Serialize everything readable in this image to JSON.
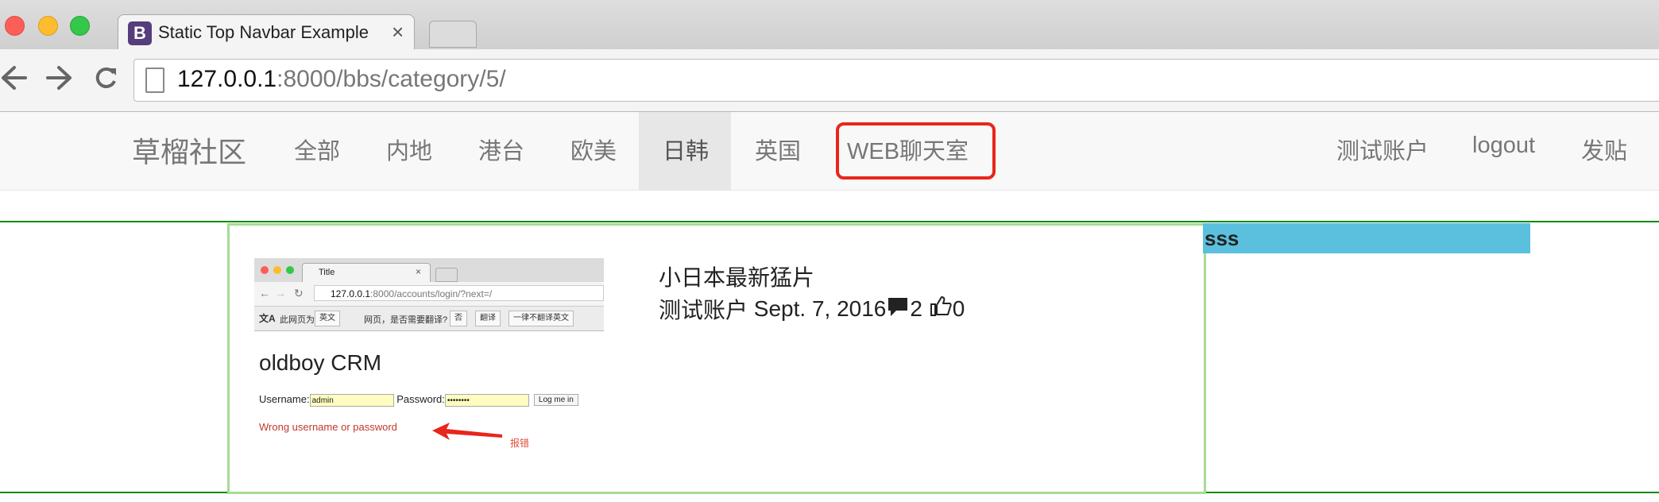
{
  "browser": {
    "tab_favicon": "B",
    "tab_title": "Static Top Navbar Example",
    "tab_close": "×",
    "url_host": "127.0.0.1",
    "url_rest": ":8000/bbs/category/5/"
  },
  "navbar": {
    "brand": "草榴社区",
    "links": [
      "全部",
      "内地",
      "港台",
      "欧美",
      "日韩",
      "英国",
      "WEB聊天室"
    ],
    "active_link": "日韩",
    "highlighted_link": "WEB聊天室",
    "right_links": [
      "测试账户",
      "logout",
      "发贴"
    ]
  },
  "sidebar": {
    "text": "sss"
  },
  "post": {
    "title": "小日本最新猛片",
    "author": "测试账户",
    "date": "Sept. 7, 2016",
    "comment_count": "2",
    "like_count": "0",
    "thumbnail": {
      "tab_title": "Title",
      "tab_close": "×",
      "url_host": "127.0.0.1",
      "url_rest": ":8000/accounts/login/?next=/",
      "translate_prefix": "此网页为",
      "translate_lang": "英文",
      "translate_question": "网页，是否需要翻译?",
      "translate_no": "否",
      "translate_yes": "翻译",
      "translate_never": "一律不翻译英文",
      "heading": "oldboy CRM",
      "username_label": "Username:",
      "username_value": "admin",
      "password_label": "Password:",
      "password_value": "••••••••",
      "login_button": "Log me in",
      "error_text": "Wrong username or password",
      "annotation": "报错"
    }
  },
  "colors": {
    "navbar_bg": "#f8f8f8",
    "active_tab_bg": "#e7e7e7",
    "highlight_border": "#e8261c",
    "sidebar_bg": "#5bc0de",
    "post_border": "#a6dc94",
    "divider_line": "#0c8a0c"
  }
}
